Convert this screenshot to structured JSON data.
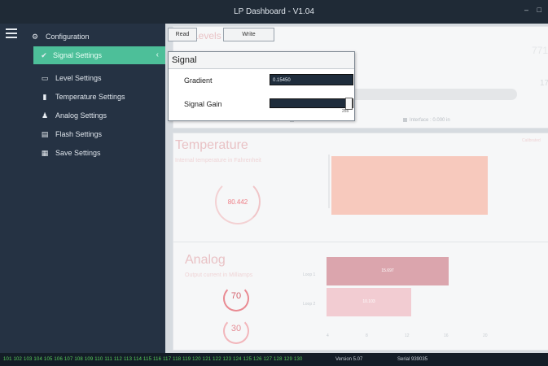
{
  "window": {
    "title": "LP Dashboard - V1.04",
    "controls": "– □"
  },
  "sidebar": {
    "items": [
      {
        "label": "Configuration",
        "icon": "gear-icon",
        "glyph": "⚙"
      },
      {
        "label": "Signal Settings",
        "icon": "check-icon",
        "glyph": "✔"
      },
      {
        "label": "Level Settings",
        "icon": "level-icon",
        "glyph": "▭"
      },
      {
        "label": "Temperature Settings",
        "icon": "thermometer-icon",
        "glyph": "▮"
      },
      {
        "label": "Analog Settings",
        "icon": "people-icon",
        "glyph": "♟"
      },
      {
        "label": "Flash Settings",
        "icon": "save-icon",
        "glyph": "▤"
      },
      {
        "label": "Save Settings",
        "icon": "grid-icon",
        "glyph": "▦"
      }
    ],
    "active_chevron": "‹"
  },
  "toolbar": {
    "read_label": "Read",
    "write_label": "Write"
  },
  "signal_popup": {
    "title": "Signal",
    "gradient_label": "Gradient",
    "gradient_value": "0.15450",
    "signal_gain_label": "Signal Gain",
    "signal_gain_value": "255",
    "signal_gain_fraction": 1.0
  },
  "level_panel": {
    "title": "Levels",
    "right_value": "771",
    "right_partial": "177",
    "legend_1": "Product : 180.044 in",
    "legend_2": "Interface : 0.000 in"
  },
  "temperature_panel": {
    "title": "Temperature",
    "subtitle": "Internal temperature in Fahrenheit",
    "gauge_value": "80.442",
    "corner_label": "Calibrated"
  },
  "analog_panel": {
    "title": "Analog",
    "subtitle": "Output current in Milliamps",
    "gauge_1": "70",
    "gauge_2": "30",
    "bars": [
      {
        "label": "Loop 1",
        "value": "15.697"
      },
      {
        "label": "Loop 2",
        "value": "10.103"
      }
    ],
    "axis": [
      "4",
      "8",
      "12",
      "16",
      "20"
    ]
  },
  "statusbar": {
    "numbers": "101 102 103 104 105 106 107 108 109 110 111 112 113 114 115 116 117 118 119 120 121 122 123 124 125 126 127 128 129 130",
    "version": "Version  5.07",
    "serial": "Serial  939035"
  }
}
